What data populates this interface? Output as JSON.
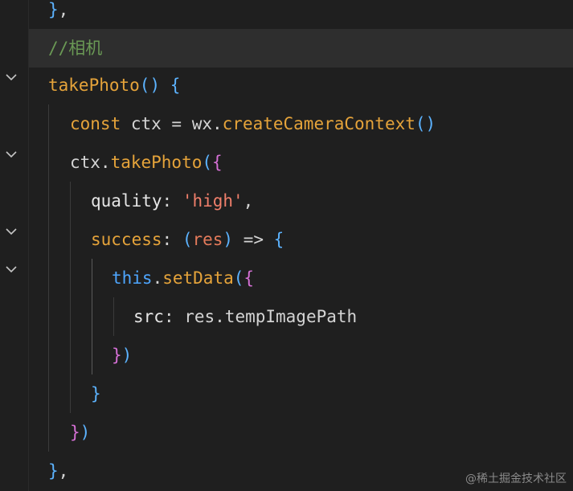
{
  "editor": {
    "lines": [
      {
        "id": "l1",
        "tokens": [
          [
            "}",
            "c-paren1"
          ],
          [
            ",",
            "c-punc"
          ]
        ]
      },
      {
        "id": "l2",
        "tokens": [
          [
            "//相机",
            "c-comment"
          ]
        ]
      },
      {
        "id": "l3",
        "tokens": [
          [
            "takePhoto",
            "c-func"
          ],
          [
            "()",
            "c-paren1"
          ],
          [
            " ",
            "c-punc"
          ],
          [
            "{",
            "c-paren1"
          ]
        ]
      },
      {
        "id": "l4",
        "tokens": [
          [
            "const",
            "c-kw"
          ],
          [
            " ctx = wx.",
            "c-var"
          ],
          [
            "createCameraContext",
            "c-func"
          ],
          [
            "()",
            "c-paren1"
          ]
        ]
      },
      {
        "id": "l5",
        "tokens": [
          [
            "ctx.",
            "c-var"
          ],
          [
            "takePhoto",
            "c-func"
          ],
          [
            "(",
            "c-paren1"
          ],
          [
            "{",
            "c-paren2"
          ]
        ]
      },
      {
        "id": "l6",
        "tokens": [
          [
            "quality",
            "c-prop"
          ],
          [
            ": ",
            "c-punc"
          ],
          [
            "'high'",
            "c-str"
          ],
          [
            ",",
            "c-punc"
          ]
        ]
      },
      {
        "id": "l7",
        "tokens": [
          [
            "success",
            "c-func"
          ],
          [
            ": ",
            "c-punc"
          ],
          [
            "(",
            "c-paren1"
          ],
          [
            "res",
            "c-param"
          ],
          [
            ")",
            "c-paren1"
          ],
          [
            " => ",
            "c-var"
          ],
          [
            "{",
            "c-paren1"
          ]
        ]
      },
      {
        "id": "l8",
        "tokens": [
          [
            "this",
            "c-this"
          ],
          [
            ".",
            "c-var"
          ],
          [
            "setData",
            "c-func"
          ],
          [
            "(",
            "c-paren1"
          ],
          [
            "{",
            "c-paren2"
          ]
        ]
      },
      {
        "id": "l9",
        "tokens": [
          [
            "src",
            "c-prop"
          ],
          [
            ": res.tempImagePath",
            "c-var"
          ]
        ]
      },
      {
        "id": "l10",
        "tokens": [
          [
            "}",
            "c-paren2"
          ],
          [
            ")",
            "c-paren1"
          ]
        ]
      },
      {
        "id": "l11",
        "tokens": [
          [
            "}",
            "c-paren1"
          ]
        ]
      },
      {
        "id": "l12",
        "tokens": [
          [
            "}",
            "c-paren2"
          ],
          [
            ")",
            "c-paren1"
          ]
        ]
      },
      {
        "id": "l13",
        "tokens": [
          [
            "}",
            "c-paren1"
          ],
          [
            ",",
            "c-punc"
          ]
        ]
      }
    ]
  },
  "watermark": "@稀土掘金技术社区"
}
